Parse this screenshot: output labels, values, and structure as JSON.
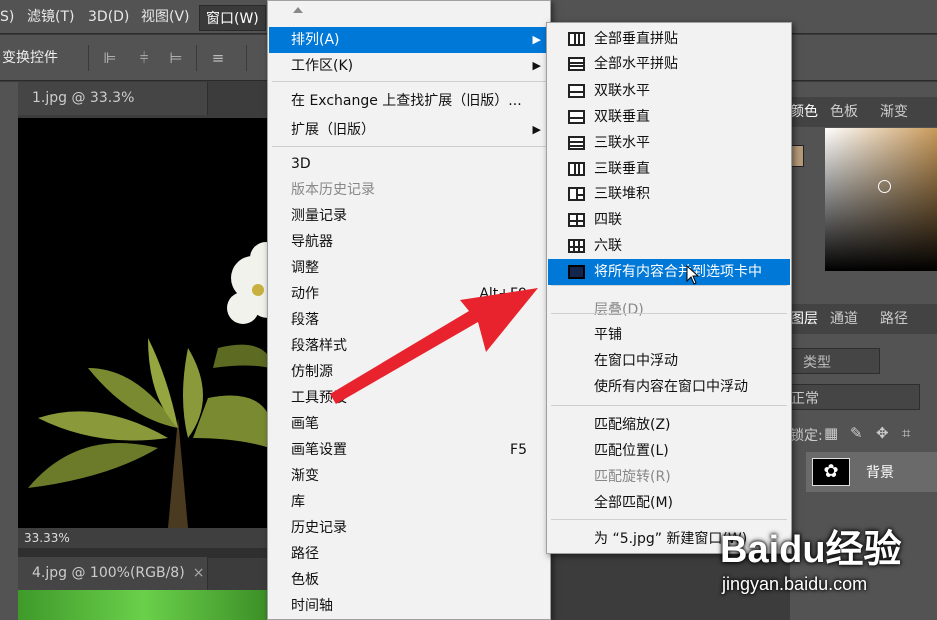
{
  "menubar": {
    "items": [
      "S)",
      "滤镜(T)",
      "3D(D)",
      "视图(V)",
      "窗口(W)"
    ]
  },
  "optionsbar": {
    "label": "变换控件"
  },
  "doc_tabs": {
    "tab1": "1.jpg @ 33.3%(RGB/8)",
    "tab2": "4.jpg @ 100%(RGB/8)",
    "close": "×",
    "zoom": "33.33%"
  },
  "right_panel": {
    "color_tabs": [
      "颜色",
      "色板",
      "渐变"
    ],
    "layer_tabs": [
      "图层",
      "通道",
      "路径"
    ],
    "filter_type": "类型",
    "blend_mode": "正常",
    "lock_label": "锁定:",
    "layer_name": "背景"
  },
  "window_menu": {
    "items": [
      {
        "label": "排列(A)",
        "submenu": true,
        "highlighted": true
      },
      {
        "label": "工作区(K)",
        "submenu": true
      },
      {
        "label": "在 Exchange 上查找扩展（旧版）..."
      },
      {
        "label": "扩展（旧版）",
        "submenu": true
      },
      {
        "label": "3D"
      },
      {
        "label": "版本历史记录",
        "disabled": true
      },
      {
        "label": "测量记录"
      },
      {
        "label": "导航器"
      },
      {
        "label": "调整"
      },
      {
        "label": "动作",
        "shortcut": "Alt+F9"
      },
      {
        "label": "段落"
      },
      {
        "label": "段落样式"
      },
      {
        "label": "仿制源"
      },
      {
        "label": "工具预设"
      },
      {
        "label": "画笔"
      },
      {
        "label": "画笔设置",
        "shortcut": "F5"
      },
      {
        "label": "渐变"
      },
      {
        "label": "库"
      },
      {
        "label": "历史记录"
      },
      {
        "label": "路径"
      },
      {
        "label": "色板"
      },
      {
        "label": "时间轴"
      }
    ]
  },
  "arrange_submenu": {
    "items": [
      {
        "label": "全部垂直拼贴",
        "icon": "tile-vertical-icon"
      },
      {
        "label": "全部水平拼贴",
        "icon": "tile-horizontal-icon"
      },
      {
        "label": "双联水平",
        "icon": "two-up-horizontal-icon"
      },
      {
        "label": "双联垂直",
        "icon": "two-up-vertical-icon"
      },
      {
        "label": "三联水平",
        "icon": "three-up-horizontal-icon"
      },
      {
        "label": "三联垂直",
        "icon": "three-up-vertical-icon"
      },
      {
        "label": "三联堆积",
        "icon": "three-up-stacked-icon"
      },
      {
        "label": "四联",
        "icon": "four-up-icon"
      },
      {
        "label": "六联",
        "icon": "six-up-icon"
      },
      {
        "label": "将所有内容合并到选项卡中",
        "icon": "consolidate-tabs-icon",
        "highlighted": true
      },
      {
        "label": "层叠(D)",
        "disabled": true
      },
      {
        "label": "平铺"
      },
      {
        "label": "在窗口中浮动"
      },
      {
        "label": "使所有内容在窗口中浮动"
      },
      {
        "label": "匹配缩放(Z)"
      },
      {
        "label": "匹配位置(L)"
      },
      {
        "label": "匹配旋转(R)",
        "disabled": true
      },
      {
        "label": "全部匹配(M)"
      },
      {
        "label": "为 “5.jpg” 新建窗口(W)"
      }
    ]
  },
  "watermark": {
    "brand": "Baidu经验",
    "url": "jingyan.baidu.com"
  },
  "colors": {
    "highlight": "#0078d7",
    "arrow": "#e8232d",
    "menu_bg": "#f2f2f2"
  }
}
